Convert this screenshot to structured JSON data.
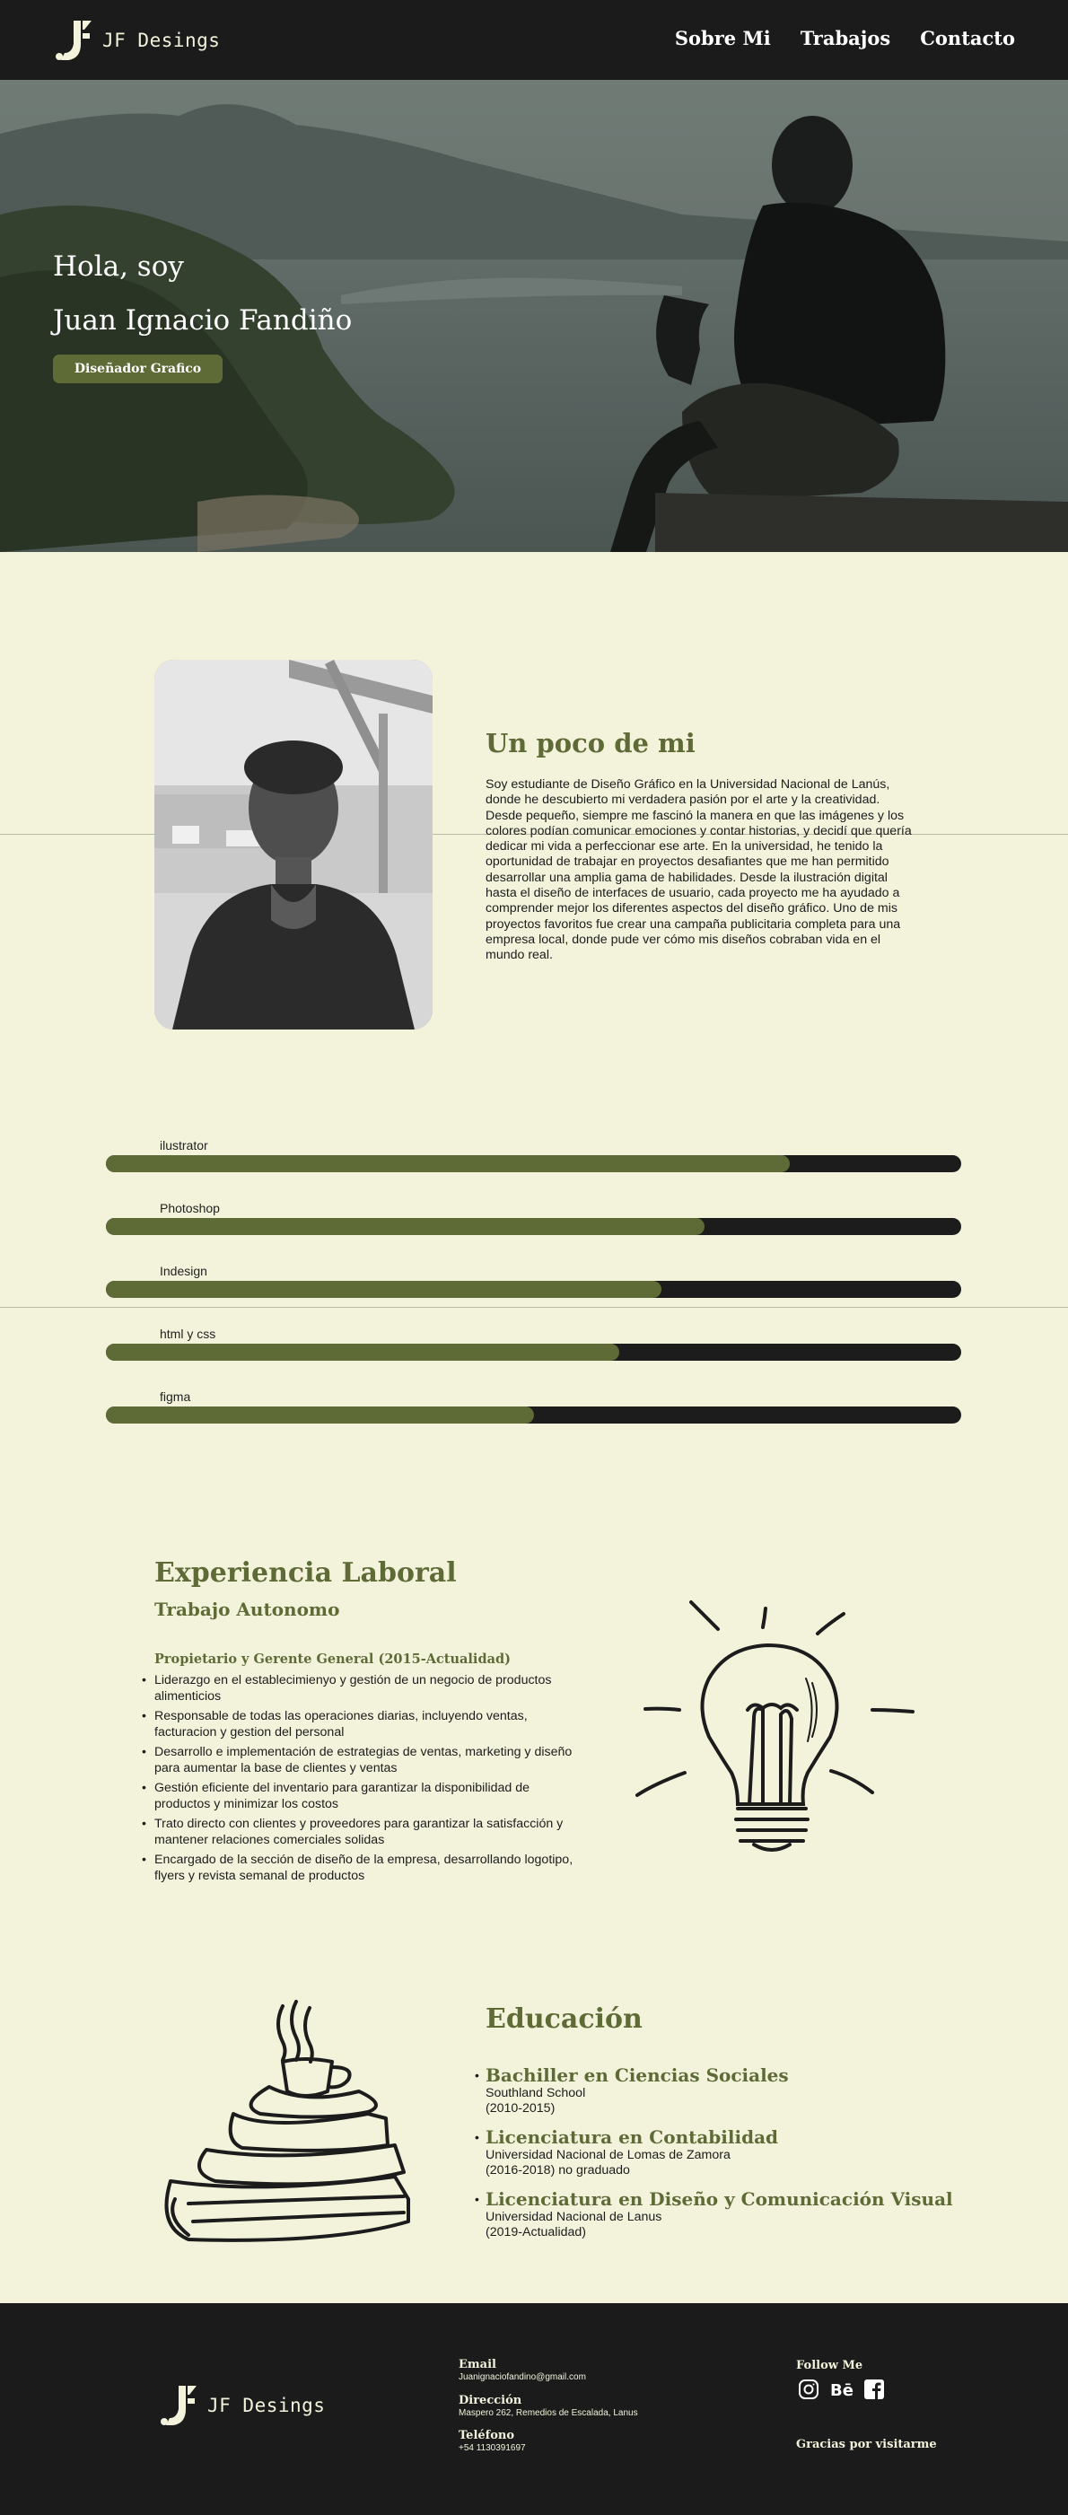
{
  "nav": {
    "logo_text": "JF Desings",
    "links": [
      "Sobre Mi",
      "Trabajos",
      "Contacto"
    ]
  },
  "hero": {
    "greeting": "Hola, soy",
    "name": "Juan Ignacio Fandiño",
    "button": "Diseñador Grafico"
  },
  "about": {
    "title": "Un poco de mi",
    "text": "Soy estudiante de Diseño Gráfico en la Universidad Nacional de Lanús, donde he descubierto mi verdadera pasión por el arte y la creatividad. Desde pequeño, siempre me fascinó la manera en que las imágenes y los colores podían comunicar emociones y contar historias, y decidí que quería dedicar mi vida a perfeccionar ese arte. En la universidad, he tenido la oportunidad de trabajar en proyectos desafiantes que me han permitido desarrollar una amplia gama de habilidades. Desde la ilustración digital hasta el diseño de interfaces de usuario, cada proyecto me ha ayudado a comprender mejor los diferentes aspectos del diseño gráfico. Uno de mis proyectos favoritos fue crear una campaña publicitaria completa para una empresa local, donde pude ver cómo mis diseños cobraban vida en el mundo real."
  },
  "skills": [
    {
      "label": "ilustrator",
      "level": 0.8
    },
    {
      "label": "Photoshop",
      "level": 0.7
    },
    {
      "label": "Indesign",
      "level": 0.65
    },
    {
      "label": "html y css",
      "level": 0.6
    },
    {
      "label": "figma",
      "level": 0.5
    }
  ],
  "experience": {
    "title": "Experiencia Laboral",
    "subtitle": "Trabajo Autonomo",
    "role": "Propietario y Gerente General (2015-Actualidad)",
    "items": [
      "Liderazgo en el establecimienyo y gestión de un negocio de productos alimenticios",
      "Responsable de todas las operaciones diarias, incluyendo ventas, facturacion y gestion del personal",
      "Desarrollo e implementación de estrategias de ventas, marketing y diseño para aumentar la base de clientes y ventas",
      "Gestión eficiente del inventario para garantizar la disponibilidad de productos y minimizar los costos",
      "Trato directo con clientes y proveedores para garantizar la satisfacción y mantener relaciones comerciales solidas",
      "Encargado de la sección de diseño de la empresa, desarrollando logotipo, flyers y revista semanal de productos"
    ]
  },
  "education": {
    "title": "Educación",
    "items": [
      {
        "degree": "Bachiller en Ciencias Sociales",
        "school": "Southland School",
        "years": "(2010-2015)"
      },
      {
        "degree": "Licenciatura en Contabilidad",
        "school": "Universidad Nacional de Lomas de Zamora",
        "years": "(2016-2018) no graduado"
      },
      {
        "degree": "Licenciatura en Diseño y Comunicación Visual",
        "school": "Universidad Nacional de Lanus",
        "years": "(2019-Actualidad)"
      }
    ]
  },
  "footer": {
    "logo_text": "JF Desings",
    "email_label": "Email",
    "email": "Juanignaciofandino@gmail.com",
    "address_label": "Dirección",
    "address": "Maspero 262, Remedios de Escalada, Lanus",
    "phone_label": "Teléfono",
    "phone": "+54 1130391697",
    "follow": "Follow Me",
    "thanks": "Gracias por visitarme"
  },
  "colors": {
    "olive": "#5f6b36",
    "cream": "#f3f3dc",
    "dark": "#1b1b1b"
  },
  "icons": [
    "logo-mark-icon",
    "instagram-icon",
    "behance-icon",
    "facebook-icon",
    "lightbulb-illustration",
    "books-coffee-illustration"
  ]
}
